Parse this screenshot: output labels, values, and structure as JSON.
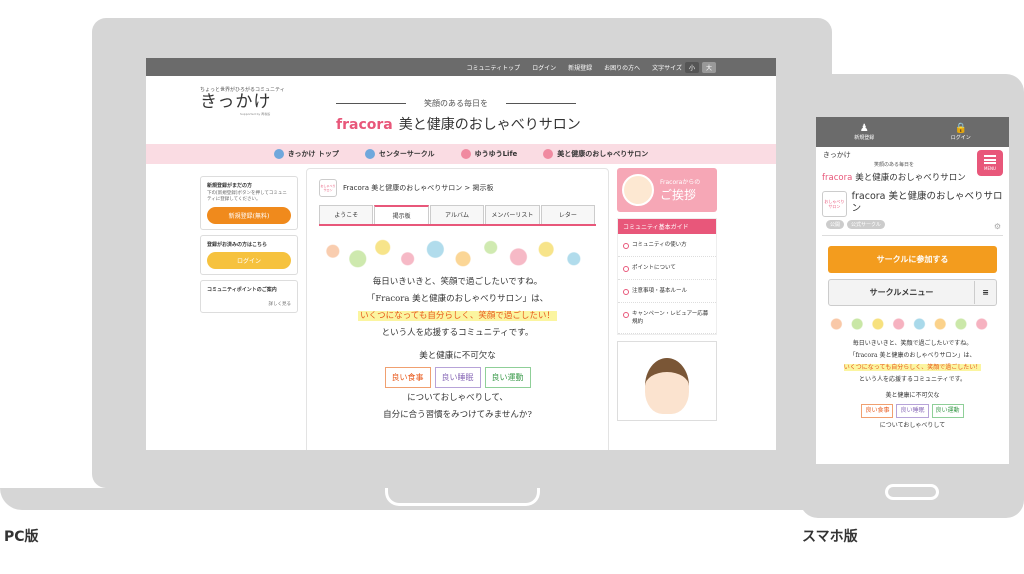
{
  "labels": {
    "pc": "PC版",
    "sp": "スマホ版"
  },
  "pc": {
    "topbar": {
      "links": [
        "コミュニティトップ",
        "ログイン",
        "新規登録",
        "お困りの方へ",
        "文字サイズ"
      ],
      "font_small": "小",
      "font_large": "大"
    },
    "logo": {
      "tagline": "ちょっと世界がひろがるコミュニティ",
      "name": "きっかけ",
      "supported": "Supported by 再春館"
    },
    "hero": {
      "tagline": "笑顔のある毎日を",
      "brand": "fracora",
      "title": "美と健康のおしゃべりサロン"
    },
    "nav": [
      "きっかけ トップ",
      "センターサークル",
      "ゆうゆうLife",
      "美と健康のおしゃべりサロン"
    ],
    "left": {
      "register_title": "新規登録がまだの方",
      "register_desc": "下の[新規登録]ボタンを押してコミュニティに登録してください。",
      "register_btn": "新規登録(無料)",
      "login_title": "登録がお済みの方はこちら",
      "login_btn": "ログイン",
      "points_title": "コミュニティポイントのご案内",
      "points_more": "詳しく見る"
    },
    "breadcrumb": "Fracora 美と健康のおしゃべりサロン > 掲示板",
    "circle_icon": "おしゃべりサロン",
    "tabs": [
      "ようこそ",
      "掲示板",
      "アルバム",
      "メンバーリスト",
      "レター"
    ],
    "intro": {
      "l1": "毎日いきいきと、笑顔で過ごしたいですね。",
      "l2": "「Fracora 美と健康のおしゃべりサロン」は、",
      "l3": "いくつになっても自分らしく、笑顔で過ごしたい！",
      "l4": "という人を応援するコミュニティです。",
      "l5": "美と健康に不可欠な",
      "cat_food": "良い食事",
      "cat_sleep": "良い睡眠",
      "cat_move": "良い運動",
      "l6": "についておしゃべりして、",
      "l7": "自分に合う習慣をみつけてみませんか?"
    },
    "right": {
      "greet_small": "Fracoraからの",
      "greet_big": "ご挨拶",
      "guide_title": "コミュニティ基本ガイド",
      "guide": [
        "コミュニティの使い方",
        "ポイントについて",
        "注意事項・基本ルール",
        "キャンペーン・レビュアー応募規約"
      ]
    }
  },
  "sp": {
    "top": {
      "register": "新規登録",
      "login": "ログイン"
    },
    "logo": "きっかけ",
    "tagline": "笑顔のある毎日を",
    "brand": "fracora",
    "title": "美と健康のおしゃべりサロン",
    "menu": "MENU",
    "circle_name": "fracora 美と健康のおしゃべりサロン",
    "tags": [
      "公開",
      "公式サークル"
    ],
    "join_btn": "サークルに参加する",
    "menu_btn": "サークルメニュー",
    "intro": {
      "l1": "毎日いきいきと、笑顔で過ごしたいですね。",
      "l2": "「fracora 美と健康のおしゃべりサロン」は、",
      "l3": "いくつになっても自分らしく、笑顔で過ごしたい！",
      "l4": "という人を応援するコミュニティです。",
      "l5": "美と健康に不可欠な",
      "cat_food": "良い食事",
      "cat_sleep": "良い睡眠",
      "cat_move": "良い運動",
      "l6": "についておしゃべりして"
    }
  }
}
